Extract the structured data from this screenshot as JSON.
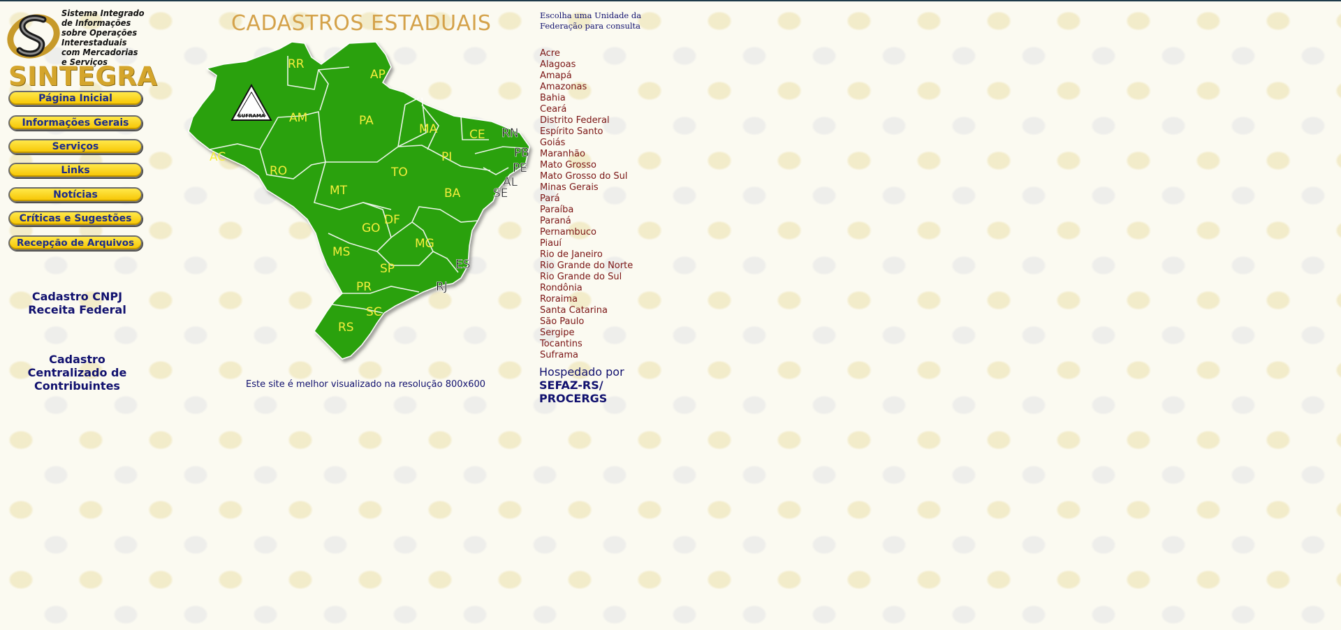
{
  "logo": {
    "text_lines": [
      "Sistema Integrado",
      "de Informações",
      "sobre Operações",
      "Interestaduais",
      "com Mercadorias",
      "e Serviços"
    ],
    "wordmark": "SINTEGRA"
  },
  "nav": [
    {
      "label": "Página Inicial"
    },
    {
      "label": "Informações Gerais"
    },
    {
      "label": "Serviços"
    },
    {
      "label": "Links"
    },
    {
      "label": "Notícias"
    },
    {
      "label": "Críticas e Sugestões"
    },
    {
      "label": "Recepção de Arquivos"
    }
  ],
  "side_links": {
    "cnpj_line1": "Cadastro CNPJ",
    "cnpj_line2": "Receita Federal",
    "ccc_line1": "Cadastro",
    "ccc_line2": "Centralizado de",
    "ccc_line3": "Contribuintes"
  },
  "main": {
    "title": "CADASTROS ESTADUAIS",
    "resolution_note": "Este site é melhor visualizado na resolução 800x600"
  },
  "map": {
    "fill_color": "#2aa10f",
    "label_color": "#f5ee3c",
    "suframa_badge": "SUFRAMA",
    "state_labels": [
      "RR",
      "AP",
      "AM",
      "PA",
      "MA",
      "CE",
      "RN",
      "PB",
      "PE",
      "AL",
      "SE",
      "PI",
      "AC",
      "RO",
      "MT",
      "TO",
      "BA",
      "DF",
      "GO",
      "MS",
      "MG",
      "ES",
      "SP",
      "RJ",
      "PR",
      "SC",
      "RS"
    ]
  },
  "right": {
    "choose_line1": "Escolha uma Unidade da",
    "choose_line2": "Federação para consulta",
    "states": [
      "Acre",
      "Alagoas",
      "Amapá",
      "Amazonas",
      "Bahia",
      "Ceará",
      "Distrito Federal",
      "Espírito Santo",
      "Goiás",
      "Maranhão",
      "Mato Grosso",
      "Mato Grosso do Sul",
      "Minas Gerais",
      "Pará",
      "Paraíba",
      "Paraná",
      "Pernambuco",
      "Piauí",
      "Rio de Janeiro",
      "Rio Grande do Norte",
      "Rio Grande do Sul",
      "Rondônia",
      "Roraima",
      "Santa Catarina",
      "São Paulo",
      "Sergipe",
      "Tocantins",
      "Suframa"
    ],
    "hosted_label": "Hospedado por",
    "hosted_line1": "SEFAZ-RS/",
    "hosted_line2": "PROCERGS"
  }
}
